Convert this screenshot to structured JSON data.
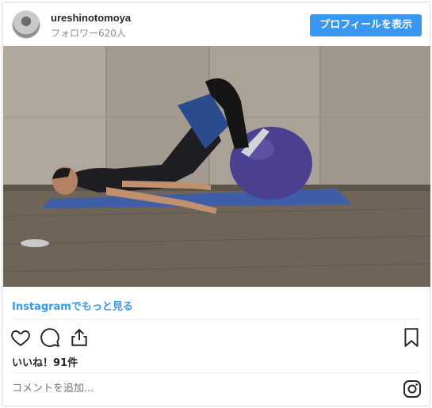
{
  "header": {
    "username": "ureshinotomoya",
    "followers": "フォロワー620人",
    "profile_button": "プロフィールを表示"
  },
  "media": {
    "alt_icon": "video-thumbnail"
  },
  "links": {
    "more_on_instagram": "Instagramでもっと見る"
  },
  "actions": {
    "icons": [
      "heart-icon",
      "comment-icon",
      "share-icon",
      "bookmark-icon"
    ]
  },
  "post": {
    "likes": "いいね！91件"
  },
  "comment": {
    "placeholder": "コメントを追加..."
  },
  "colors": {
    "accent": "#3897f0",
    "text": "#262626",
    "muted": "#8e8e8e",
    "border": "#dbdbdb"
  }
}
